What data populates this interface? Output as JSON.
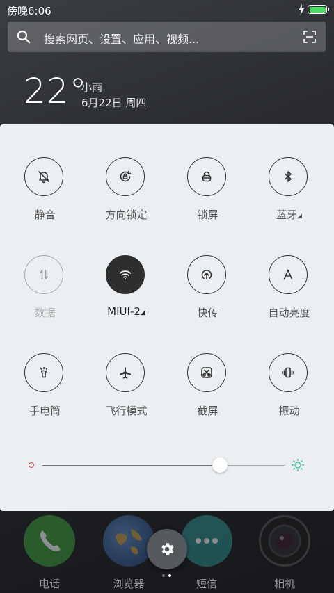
{
  "status_bar": {
    "time": "傍晚6:06",
    "battery_level": 1.0,
    "charging": true
  },
  "search": {
    "placeholder": "搜索网页、设置、应用、视频..."
  },
  "weather": {
    "temperature": "22°",
    "condition": "小雨",
    "date": "6月22日 周四"
  },
  "toggles": [
    {
      "id": "mute",
      "label": "静音",
      "icon": "bell-off-icon",
      "state": "off"
    },
    {
      "id": "rotation-lock",
      "label": "方向锁定",
      "icon": "rotation-lock-icon",
      "state": "off"
    },
    {
      "id": "lock-screen",
      "label": "锁屏",
      "icon": "lock-icon",
      "state": "off"
    },
    {
      "id": "bluetooth",
      "label": "蓝牙",
      "icon": "bluetooth-icon",
      "state": "off",
      "has_more": true
    },
    {
      "id": "mobile-data",
      "label": "数据",
      "icon": "data-arrows-icon",
      "state": "disabled"
    },
    {
      "id": "wifi",
      "label": "MIUI-2",
      "icon": "wifi-icon",
      "state": "on",
      "has_more": true
    },
    {
      "id": "quick-transfer",
      "label": "快传",
      "icon": "upload-icon",
      "state": "off"
    },
    {
      "id": "auto-brightness",
      "label": "自动亮度",
      "icon": "letter-a-icon",
      "state": "off"
    },
    {
      "id": "flashlight",
      "label": "手电筒",
      "icon": "flashlight-icon",
      "state": "off"
    },
    {
      "id": "airplane-mode",
      "label": "飞行模式",
      "icon": "airplane-icon",
      "state": "off"
    },
    {
      "id": "screenshot",
      "label": "截屏",
      "icon": "scissors-icon",
      "state": "off"
    },
    {
      "id": "vibrate",
      "label": "振动",
      "icon": "vibrate-icon",
      "state": "off"
    }
  ],
  "brightness": {
    "value": 0.73
  },
  "dock": [
    {
      "label": "电话",
      "icon": "phone-icon"
    },
    {
      "label": "浏览器",
      "icon": "globe-icon"
    },
    {
      "label": "短信",
      "icon": "message-icon"
    },
    {
      "label": "相机",
      "icon": "camera-icon"
    }
  ],
  "page_indicator": {
    "count": 2,
    "current": 1
  },
  "colors": {
    "active_tile": "#2e2e2e",
    "panel_bg": "#eceff1",
    "battery": "#4cd964",
    "brightness_min": "#e45050",
    "brightness_max": "#3fbfa0"
  }
}
